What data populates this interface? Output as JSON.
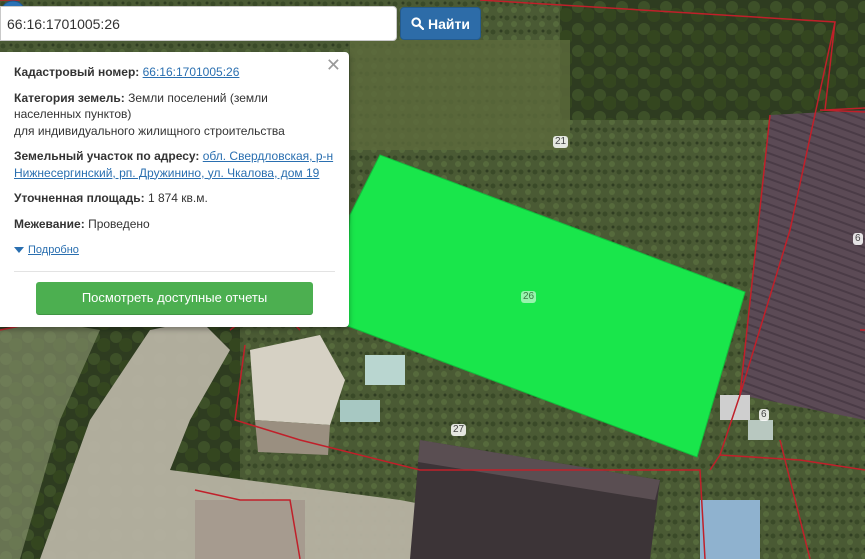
{
  "search": {
    "value": "66:16:1701005:26",
    "button_label": "Найти"
  },
  "popup": {
    "cadastral_label": "Кадастровый номер:",
    "cadastral_value": "66:16:1701005:26",
    "category_label": "Категория земель:",
    "category_value": "Земли поселений (земли населенных пунктов)",
    "category_use": "для индивидуального жилищного строительства",
    "address_label": "Земельный участок по адресу:",
    "address_value": "обл. Свердловская, р-н Нижнесергинский, рп. Дружинино, ул. Чкалова, дом 19",
    "area_label": "Уточненная площадь:",
    "area_value": "1 874 кв.м.",
    "survey_label": "Межевание:",
    "survey_value": "Проведено",
    "details_label": "Подробно",
    "report_button": "Посмотреть доступные отчеты"
  },
  "map": {
    "parcel_color": "#19e64b",
    "boundary_color": "#c0202a",
    "marker_color": "#2a72b5",
    "labels": {
      "parcel_21": "21",
      "parcel_26": "26",
      "parcel_27": "27",
      "parcel_6_a": "6",
      "parcel_6_b": "6"
    }
  }
}
